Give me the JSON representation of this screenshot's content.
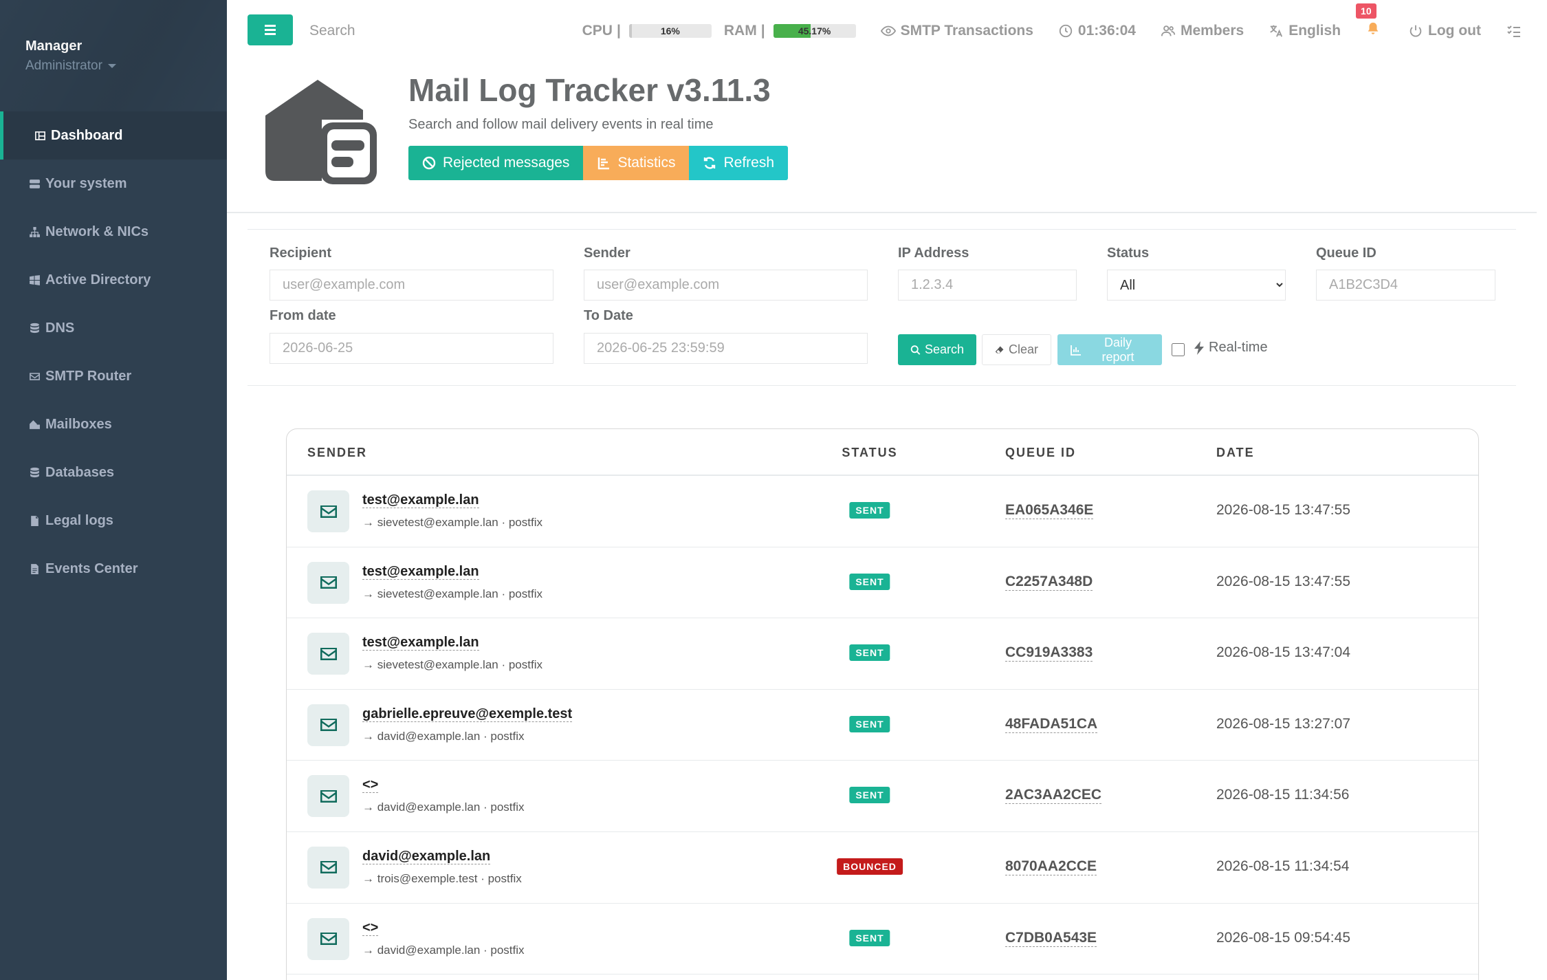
{
  "sidebar": {
    "profile": {
      "name": "Manager",
      "role": "Administrator"
    },
    "items": [
      {
        "label": "Dashboard",
        "icon": "dashboard-icon",
        "active": true
      },
      {
        "label": "Your system",
        "icon": "server-icon"
      },
      {
        "label": "Network & NICs",
        "icon": "network-icon"
      },
      {
        "label": "Active Directory",
        "icon": "windows-icon"
      },
      {
        "label": "DNS",
        "icon": "database-icon"
      },
      {
        "label": "SMTP Router",
        "icon": "envelope-icon"
      },
      {
        "label": "Mailboxes",
        "icon": "mailbox-icon"
      },
      {
        "label": "Databases",
        "icon": "database-icon"
      },
      {
        "label": "Legal logs",
        "icon": "file-icon"
      },
      {
        "label": "Events Center",
        "icon": "file-text-icon"
      }
    ]
  },
  "topbar": {
    "search_placeholder": "Search",
    "cpu": {
      "label": "CPU",
      "value": "16%",
      "percent": 16
    },
    "ram": {
      "label": "RAM",
      "value": "45.17%",
      "percent": 45.17
    },
    "smtp_transactions": "SMTP Transactions",
    "clock": "01:36:04",
    "members": "Members",
    "language": "English",
    "notifications_count": "10",
    "logout": "Log out"
  },
  "header": {
    "title": "Mail Log Tracker v3.11.3",
    "subtitle": "Search and follow mail delivery events in real time",
    "buttons": {
      "rejected": "Rejected messages",
      "statistics": "Statistics",
      "refresh": "Refresh"
    }
  },
  "filters": {
    "recipient": {
      "label": "Recipient",
      "placeholder": "user@example.com"
    },
    "sender": {
      "label": "Sender",
      "placeholder": "user@example.com"
    },
    "ip": {
      "label": "IP Address",
      "placeholder": "1.2.3.4"
    },
    "status": {
      "label": "Status",
      "value": "All"
    },
    "queue_id": {
      "label": "Queue ID",
      "placeholder": "A1B2C3D4"
    },
    "from_date": {
      "label": "From date",
      "placeholder": "2026-06-25"
    },
    "to_date": {
      "label": "To Date",
      "placeholder": "2026-06-25 23:59:59"
    },
    "search_btn": "Search",
    "clear_btn": "Clear",
    "daily_btn": "Daily report",
    "realtime_label": "Real-time"
  },
  "table": {
    "headers": {
      "sender": "SENDER",
      "status": "STATUS",
      "queue_id": "QUEUE ID",
      "date": "DATE"
    },
    "rows": [
      {
        "sender": "test@example.lan",
        "meta": "→ sievetest@example.lan · postfix",
        "status": "SENT",
        "queue_id": "EA065A346E",
        "date": "2026-08-15 13:47:55"
      },
      {
        "sender": "test@example.lan",
        "meta": "→ sievetest@example.lan · postfix",
        "status": "SENT",
        "queue_id": "C2257A348D",
        "date": "2026-08-15 13:47:55"
      },
      {
        "sender": "test@example.lan",
        "meta": "→ sievetest@example.lan · postfix",
        "status": "SENT",
        "queue_id": "CC919A3383",
        "date": "2026-08-15 13:47:04"
      },
      {
        "sender": "gabrielle.epreuve@exemple.test",
        "meta": "→ david@example.lan · postfix",
        "status": "SENT",
        "queue_id": "48FADA51CA",
        "date": "2026-08-15 13:27:07"
      },
      {
        "sender": "<>",
        "meta": "→ david@example.lan · postfix",
        "status": "SENT",
        "queue_id": "2AC3AA2CEC",
        "date": "2026-08-15 11:34:56"
      },
      {
        "sender": "david@example.lan",
        "meta": "→ trois@exemple.test · postfix",
        "status": "BOUNCED",
        "queue_id": "8070AA2CCE",
        "date": "2026-08-15 11:34:54"
      },
      {
        "sender": "<>",
        "meta": "→ david@example.lan · postfix",
        "status": "SENT",
        "queue_id": "C7DB0A543E",
        "date": "2026-08-15 09:54:45"
      }
    ]
  },
  "colors": {
    "sidebar_bg": "#2f4050",
    "primary": "#1ab394",
    "warning": "#f8ac59",
    "info": "#23c6c8",
    "danger": "#c41b1b"
  }
}
